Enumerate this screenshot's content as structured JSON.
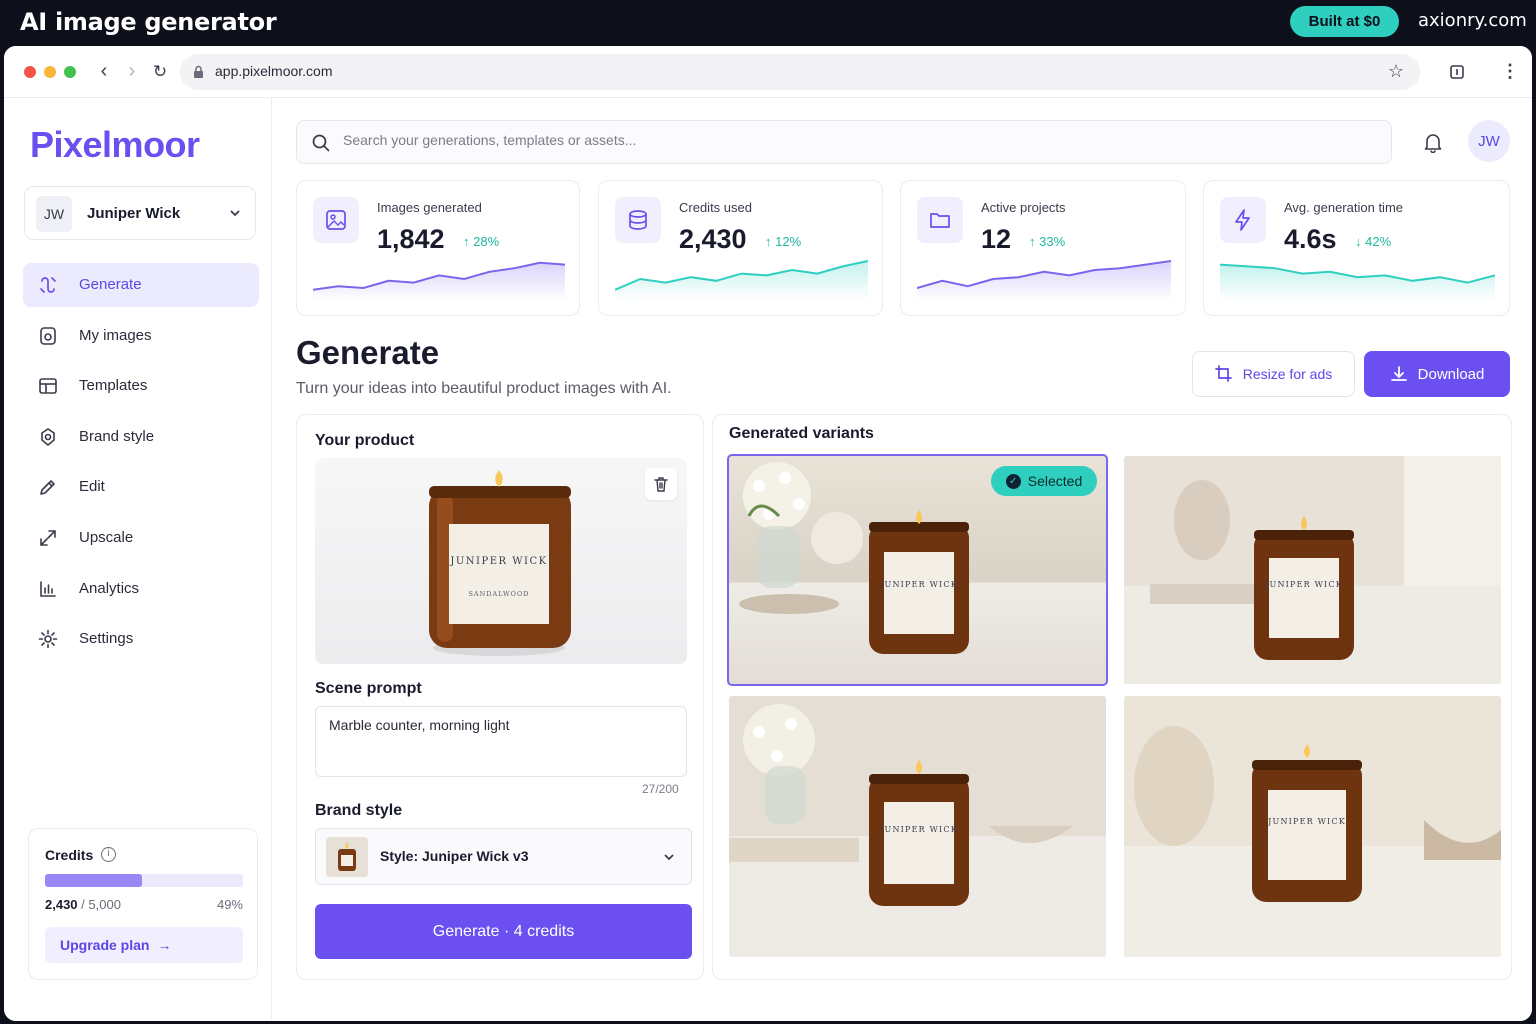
{
  "topbar": {
    "title": "AI image generator",
    "badge": "Built at $0",
    "domain": "axionry.com"
  },
  "browser": {
    "url": "app.pixelmoor.com"
  },
  "sidebar": {
    "logo": "Pixelmoor",
    "user": {
      "initials": "JW",
      "name": "Juniper Wick"
    },
    "items": [
      {
        "label": "Generate",
        "icon": "generate-icon",
        "active": true
      },
      {
        "label": "My images",
        "icon": "image-icon"
      },
      {
        "label": "Templates",
        "icon": "templates-icon"
      },
      {
        "label": "Brand style",
        "icon": "brand-icon"
      },
      {
        "label": "Edit",
        "icon": "pencil-icon"
      },
      {
        "label": "Upscale",
        "icon": "upscale-icon"
      },
      {
        "label": "Analytics",
        "icon": "chart-icon"
      },
      {
        "label": "Settings",
        "icon": "gear-icon"
      }
    ],
    "credits": {
      "title": "Credits",
      "used": "2,430",
      "total": "/ 5,000",
      "percent": "49%",
      "fill": 0.49,
      "upgrade": "Upgrade plan"
    }
  },
  "header": {
    "search_placeholder": "Search your generations, templates or assets...",
    "avatar": "JW"
  },
  "stats": [
    {
      "label": "Images generated",
      "value": "1,842",
      "delta": "28%",
      "dir": "up",
      "icon": "image-icon",
      "color": "#7a65ee"
    },
    {
      "label": "Credits used",
      "value": "2,430",
      "delta": "12%",
      "dir": "up",
      "icon": "database-icon",
      "color": "#2fcfc0"
    },
    {
      "label": "Active projects",
      "value": "12",
      "delta": "33%",
      "dir": "up",
      "icon": "folder-icon",
      "color": "#7a65ee"
    },
    {
      "label": "Avg. generation time",
      "value": "4.6s",
      "delta": "42%",
      "dir": "down",
      "icon": "lightning-icon",
      "color": "#2fcfc0"
    }
  ],
  "generate": {
    "title": "Generate",
    "subtitle": "Turn your ideas into beautiful product images with AI.",
    "resize_label": "Resize for ads",
    "download_label": "Download",
    "product_heading": "Your product",
    "product_label": {
      "brand": "JUNIPER WICK",
      "scent": "SANDALWOOD"
    },
    "scene_heading": "Scene prompt",
    "scene_prompt": "Marble counter, morning light",
    "char_count": "27/200",
    "brand_heading": "Brand style",
    "brand_value": "Style: Juniper Wick v3",
    "generate_button": "Generate · 4 credits",
    "variants_heading": "Generated variants",
    "selected_label": "Selected"
  },
  "colors": {
    "accent": "#6b4ff0",
    "teal": "#2fcfc0",
    "dark": "#0d0f1a"
  }
}
